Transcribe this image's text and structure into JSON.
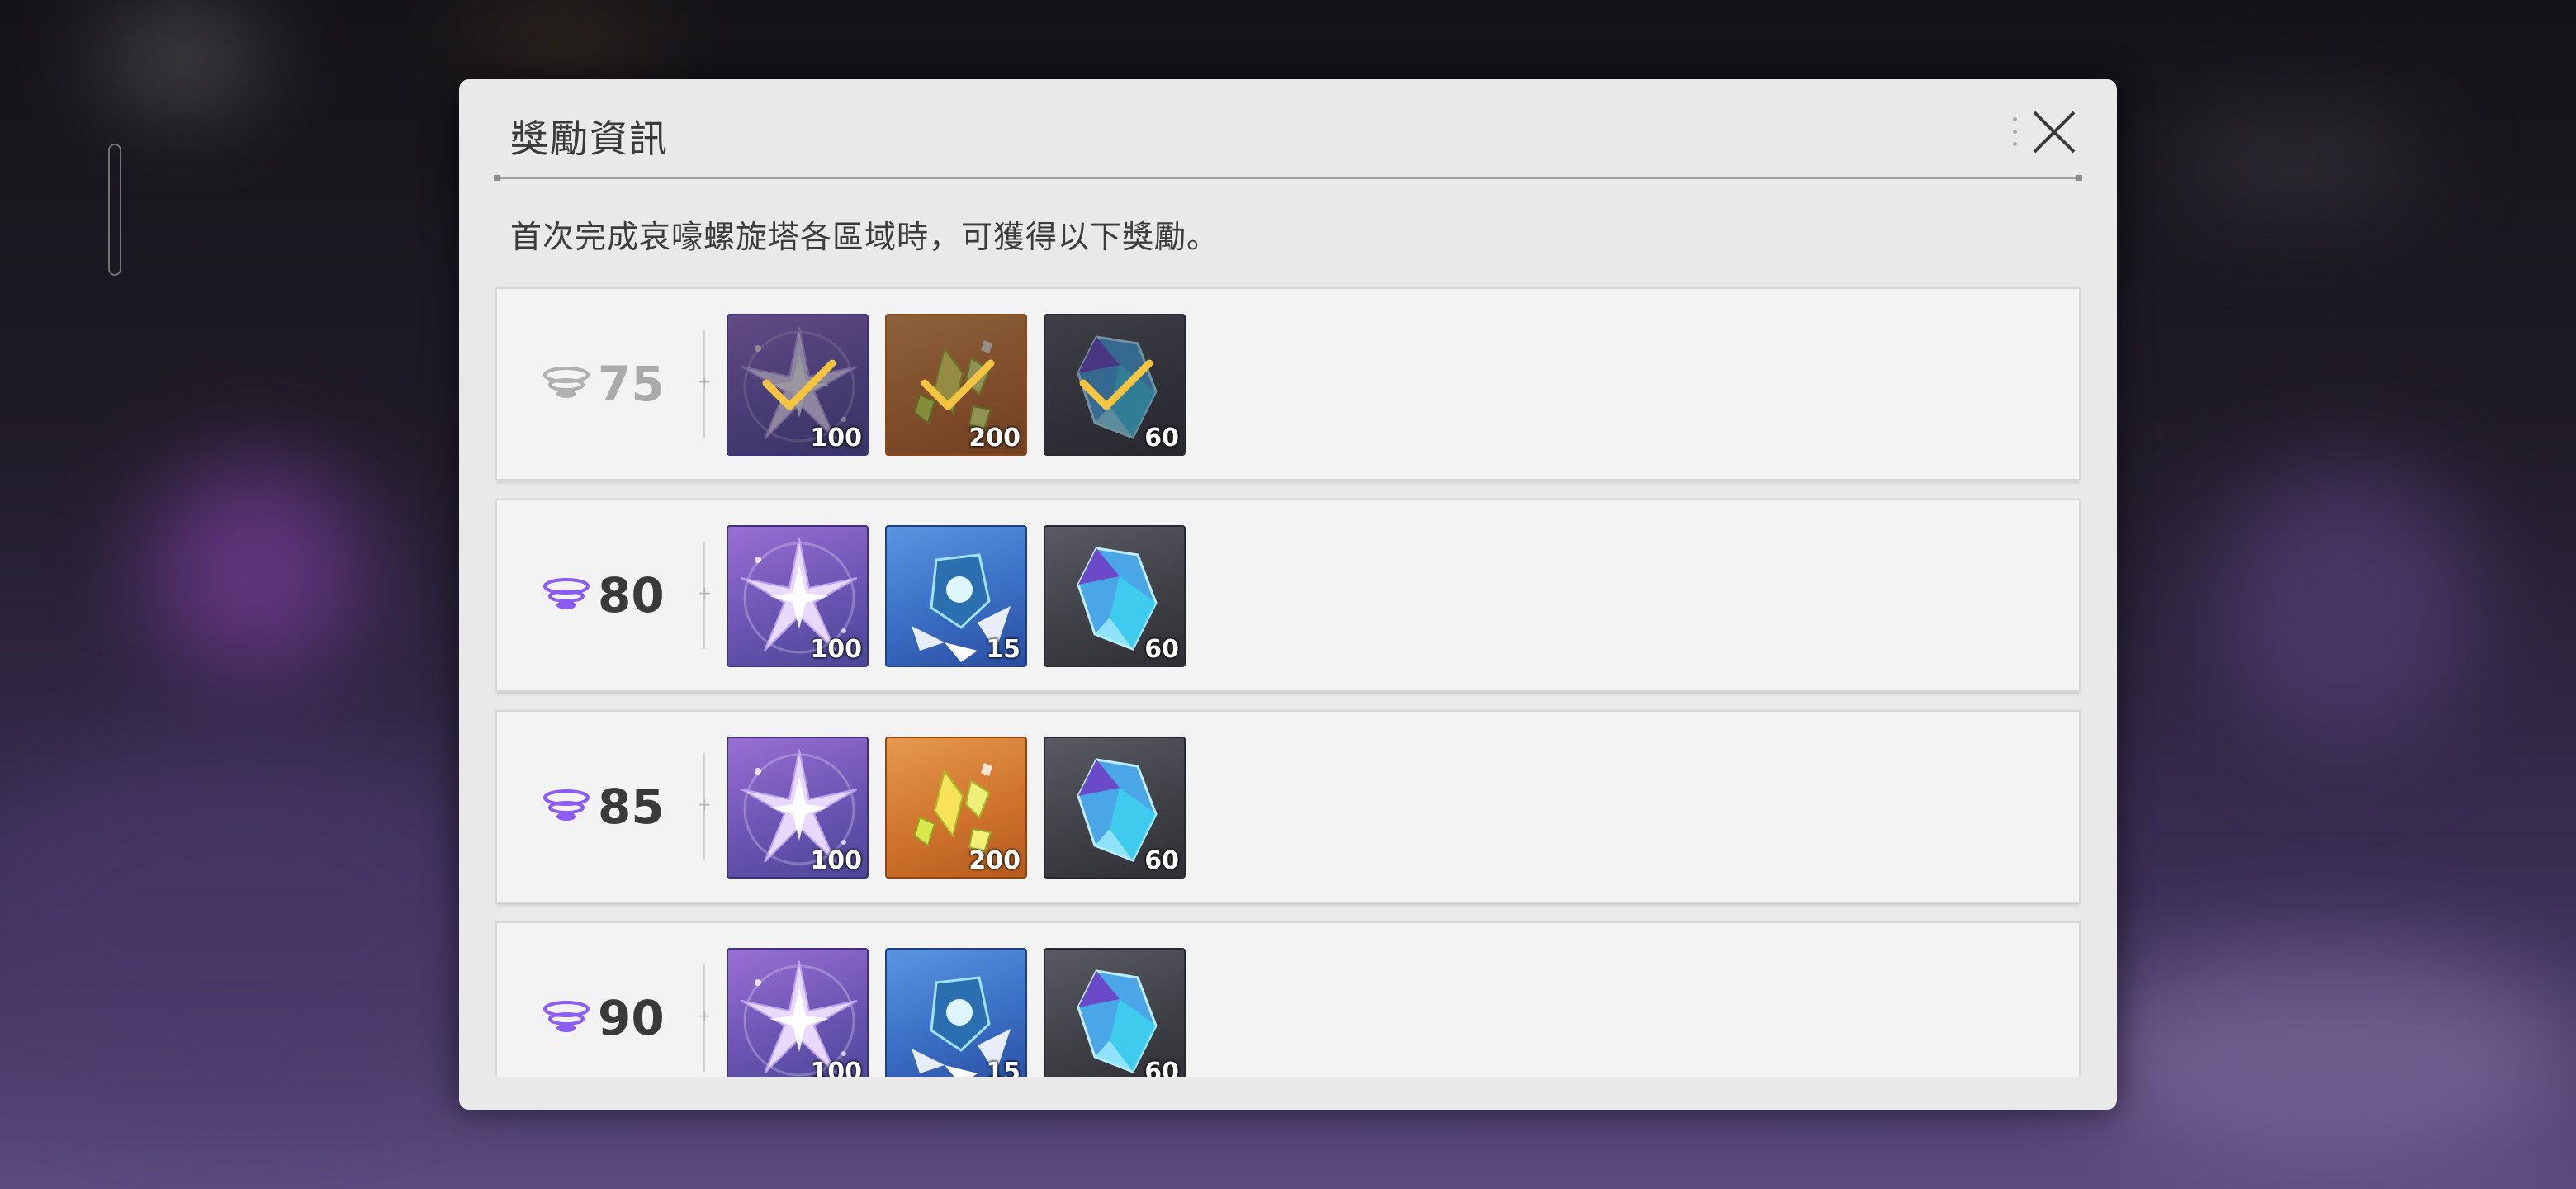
{
  "dialog": {
    "title": "獎勵資訊",
    "description": "首次完成哀嚎螺旋塔各區域時，可獲得以下獎勵。"
  },
  "icons": {
    "close": "close-icon",
    "level": "tower-level-icon",
    "claimed": "checkmark-icon"
  },
  "colors": {
    "level_active": "#8b5cf6",
    "level_done": "#b0b0b0",
    "check": "#f5c542"
  },
  "rewards": [
    {
      "level": "75",
      "claimed": true,
      "items": [
        {
          "name": "star-crystal-icon",
          "quantity": "100",
          "tier": "purple"
        },
        {
          "name": "gold-shard-icon",
          "quantity": "200",
          "tier": "orange"
        },
        {
          "name": "blue-crystal-icon",
          "quantity": "60",
          "tier": "dark"
        }
      ]
    },
    {
      "level": "80",
      "claimed": false,
      "items": [
        {
          "name": "star-crystal-icon",
          "quantity": "100",
          "tier": "purple"
        },
        {
          "name": "ice-orb-icon",
          "quantity": "15",
          "tier": "blue"
        },
        {
          "name": "blue-crystal-icon",
          "quantity": "60",
          "tier": "dark"
        }
      ]
    },
    {
      "level": "85",
      "claimed": false,
      "items": [
        {
          "name": "star-crystal-icon",
          "quantity": "100",
          "tier": "purple"
        },
        {
          "name": "gold-shard-icon",
          "quantity": "200",
          "tier": "orange"
        },
        {
          "name": "blue-crystal-icon",
          "quantity": "60",
          "tier": "dark"
        }
      ]
    },
    {
      "level": "90",
      "claimed": false,
      "items": [
        {
          "name": "star-crystal-icon",
          "quantity": "100",
          "tier": "purple"
        },
        {
          "name": "ice-orb-icon",
          "quantity": "15",
          "tier": "blue"
        },
        {
          "name": "blue-crystal-icon",
          "quantity": "60",
          "tier": "dark"
        }
      ]
    }
  ]
}
